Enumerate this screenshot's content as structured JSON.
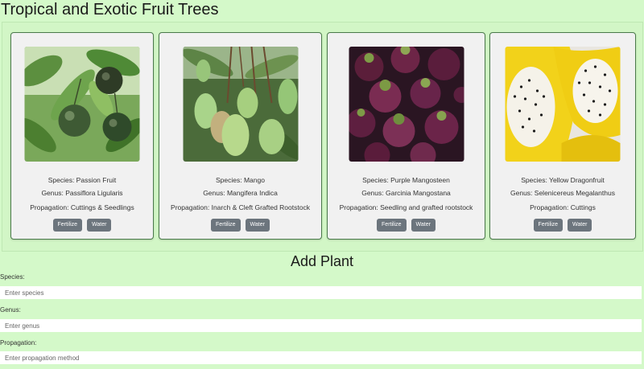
{
  "page": {
    "title": "Tropical and Exotic Fruit Trees"
  },
  "plants": [
    {
      "species": "Species: Passion Fruit",
      "genus": "Genus: Passiflora Ligularis",
      "propagation": "Propagation: Cuttings & Seedlings",
      "fertilize": "Fertilize",
      "water": "Water",
      "image": "passion-fruit-photo"
    },
    {
      "species": "Species: Mango",
      "genus": "Genus: Mangifera Indica",
      "propagation": "Propagation: Inarch & Cleft Grafted Rootstock",
      "fertilize": "Fertilize",
      "water": "Water",
      "image": "mango-photo"
    },
    {
      "species": "Species: Purple Mangosteen",
      "genus": "Genus: Garcinia Mangostana",
      "propagation": "Propagation: Seedling and grafted rootstock",
      "fertilize": "Fertilize",
      "water": "Water",
      "image": "mangosteen-photo"
    },
    {
      "species": "Species: Yellow Dragonfruit",
      "genus": "Genus: Selenicereus Megalanthus",
      "propagation": "Propagation: Cuttings",
      "fertilize": "Fertilize",
      "water": "Water",
      "image": "dragonfruit-photo"
    }
  ],
  "add_form": {
    "title": "Add Plant",
    "species_label": "Species:",
    "species_placeholder": "Enter species",
    "genus_label": "Genus:",
    "genus_placeholder": "Enter genus",
    "propagation_label": "Propagation:",
    "propagation_placeholder": "Enter propagation method"
  },
  "colors": {
    "background": "#d4f9c9",
    "card_border": "#4b7a4b",
    "button": "#6c757d"
  }
}
